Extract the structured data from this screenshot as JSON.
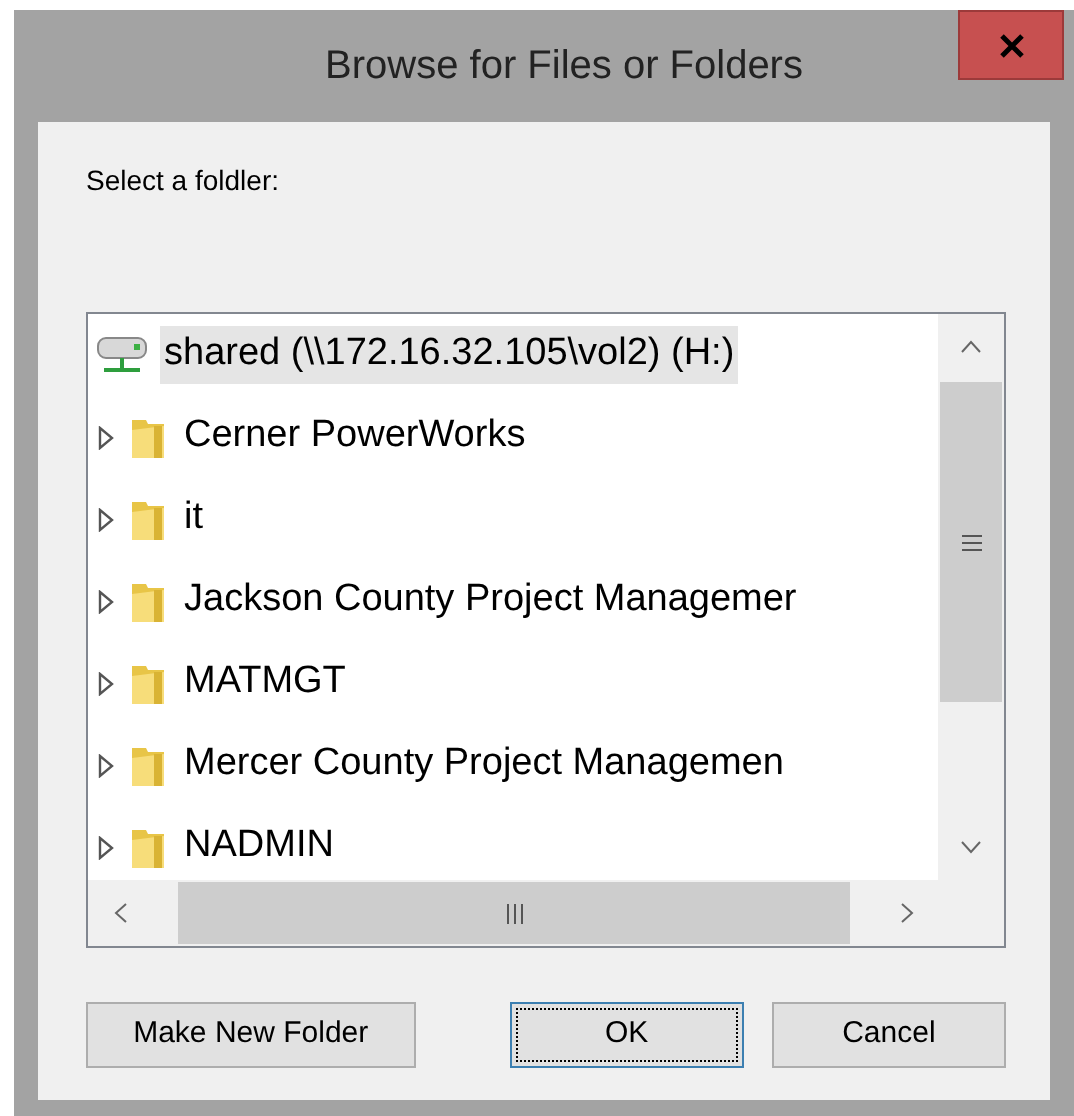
{
  "window": {
    "title": "Browse for Files or Folders"
  },
  "prompt": "Select a foldler:",
  "tree": {
    "root": {
      "label": "shared (\\\\172.16.32.105\\vol2) (H:)",
      "selected": true
    },
    "children": [
      {
        "label": "Cerner PowerWorks",
        "selected": false,
        "expanded": false
      },
      {
        "label": "it",
        "selected": false,
        "expanded": false
      },
      {
        "label": "Jackson County Project Managemer",
        "selected": false,
        "expanded": false
      },
      {
        "label": "MATMGT",
        "selected": false,
        "expanded": false
      },
      {
        "label": "Mercer County Project Managemen",
        "selected": false,
        "expanded": false
      },
      {
        "label": "NADMIN",
        "selected": false,
        "expanded": false
      }
    ]
  },
  "buttons": [
    {
      "label": "Make New Folder",
      "default": false
    },
    {
      "label": "OK",
      "default": true
    },
    {
      "label": "Cancel",
      "default": false
    }
  ]
}
